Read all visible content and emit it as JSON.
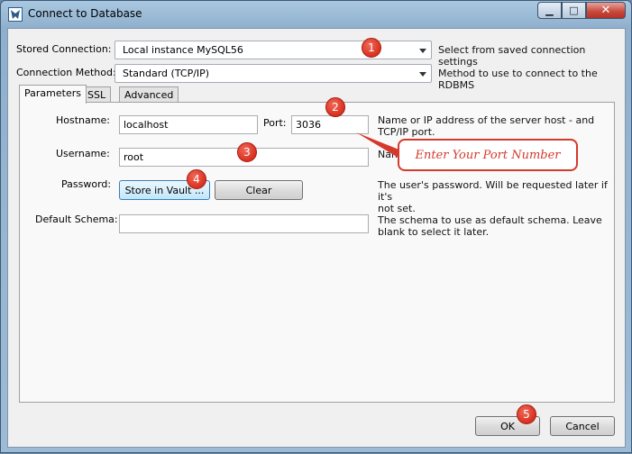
{
  "window": {
    "title": "Connect to Database"
  },
  "stored_connection": {
    "label": "Stored Connection:",
    "value": "Local instance MySQL56",
    "hint": "Select from saved connection settings"
  },
  "connection_method": {
    "label": "Connection Method:",
    "value": "Standard (TCP/IP)",
    "hint": "Method to use to connect to the RDBMS"
  },
  "tabs": [
    {
      "label": "Parameters",
      "active": true
    },
    {
      "label": "SSL",
      "active": false
    },
    {
      "label": "Advanced",
      "active": false
    }
  ],
  "parameters": {
    "hostname_label": "Hostname:",
    "hostname_value": "localhost",
    "port_label": "Port:",
    "port_value": "3036",
    "host_hint_line1": "Name or IP address of the server host - and",
    "host_hint_line2": "TCP/IP port.",
    "username_label": "Username:",
    "username_value": "root",
    "username_hint": "Nam",
    "password_label": "Password:",
    "store_vault_label": "Store in Vault ...",
    "clear_label": "Clear",
    "password_hint_line1": "The user's password. Will be requested later if it's",
    "password_hint_line2": "not set.",
    "schema_label": "Default Schema:",
    "schema_value": "",
    "schema_hint_line1": "The schema to use as default schema. Leave",
    "schema_hint_line2": "blank to select it later."
  },
  "annotations": {
    "badges": [
      "1",
      "2",
      "3",
      "4",
      "5"
    ],
    "callout": "Enter Your Port Number",
    "color": "#d9301f"
  },
  "footer": {
    "ok_label": "OK",
    "cancel_label": "Cancel"
  }
}
